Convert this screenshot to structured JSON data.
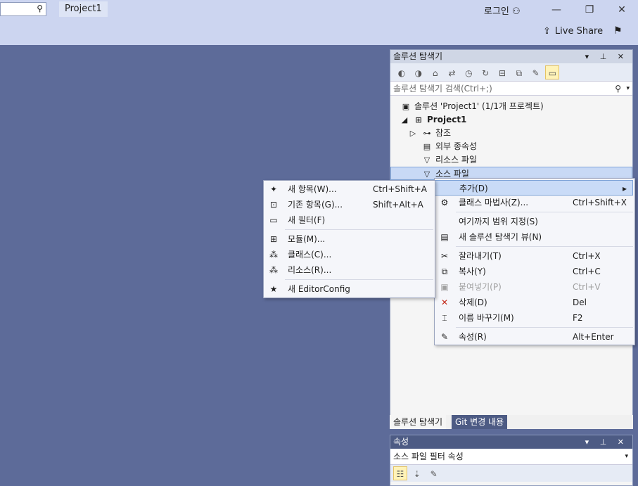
{
  "titlebar": {
    "search_icon": "search-icon",
    "project_tab": "Project1",
    "login": "로그인",
    "live_share": "Live Share"
  },
  "solution_explorer": {
    "title": "솔루션 탐색기",
    "search_placeholder": "솔루션 탐색기 검색(Ctrl+;)",
    "tree": [
      {
        "label": "솔루션 'Project1' (1/1개 프로젝트)",
        "icon": "solution-icon"
      },
      {
        "label": "Project1",
        "icon": "project-icon"
      },
      {
        "label": "참조",
        "icon": "references-icon"
      },
      {
        "label": "외부 종속성",
        "icon": "external-deps-icon"
      },
      {
        "label": "리소스 파일",
        "icon": "filter-folder-icon"
      },
      {
        "label": "소스 파일",
        "icon": "filter-folder-icon"
      }
    ],
    "tabs": [
      "솔루션 탐색기",
      "Git 변경 내용"
    ]
  },
  "properties": {
    "title": "속성",
    "selected": "소스 파일  필터 속성"
  },
  "context_menu": [
    {
      "label": "추가(D)",
      "shortcut": ""
    },
    {
      "label": "클래스 마법사(Z)...",
      "shortcut": "Ctrl+Shift+X"
    },
    {
      "label": "여기까지 범위 지정(S)",
      "shortcut": ""
    },
    {
      "label": "새 솔루션 탐색기 뷰(N)",
      "shortcut": ""
    },
    {
      "label": "잘라내기(T)",
      "shortcut": "Ctrl+X"
    },
    {
      "label": "복사(Y)",
      "shortcut": "Ctrl+C"
    },
    {
      "label": "붙여넣기(P)",
      "shortcut": "Ctrl+V"
    },
    {
      "label": "삭제(D)",
      "shortcut": "Del"
    },
    {
      "label": "이름 바꾸기(M)",
      "shortcut": "F2"
    },
    {
      "label": "속성(R)",
      "shortcut": "Alt+Enter"
    }
  ],
  "sub_menu": [
    {
      "label": "새 항목(W)...",
      "shortcut": "Ctrl+Shift+A"
    },
    {
      "label": "기존 항목(G)...",
      "shortcut": "Shift+Alt+A"
    },
    {
      "label": "새 필터(F)",
      "shortcut": ""
    },
    {
      "label": "모듈(M)...",
      "shortcut": ""
    },
    {
      "label": "클래스(C)...",
      "shortcut": ""
    },
    {
      "label": "리소스(R)...",
      "shortcut": ""
    },
    {
      "label": "새 EditorConfig",
      "shortcut": ""
    }
  ]
}
